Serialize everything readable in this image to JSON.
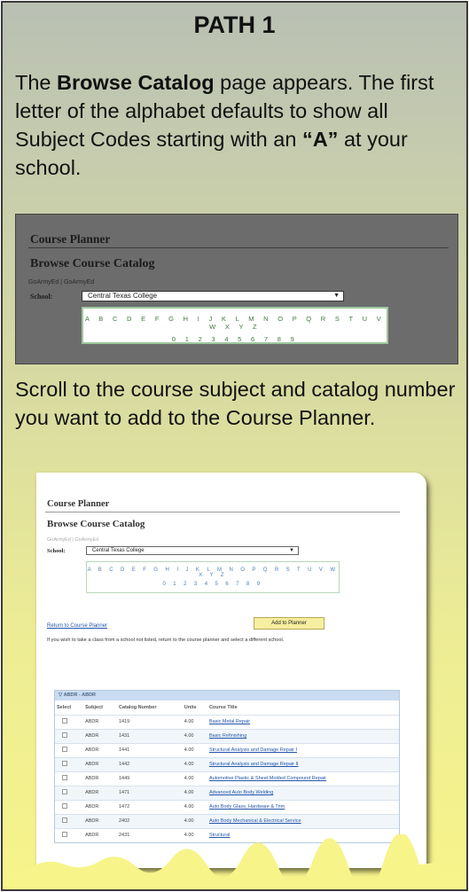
{
  "title": "PATH 1",
  "intro": {
    "part1": "The ",
    "bold1": "Browse Catalog",
    "part2": " page appears. The first letter of the alphabet defaults to show all Subject Codes starting with an ",
    "bold2": "“A”",
    "part3": " at your school."
  },
  "shot1": {
    "course_planner": "Course Planner",
    "browse_title": "Browse Course Catalog",
    "links": "GoArmyEd | GoArmyEd",
    "school_label": "School:",
    "school_value": "Central Texas College",
    "letters": "A B C D E F G H I J K L M N O P Q R S T U V W X Y Z",
    "digits": "0 1 2 3 4 5 6 7 8 9"
  },
  "scroll_text": "Scroll to the course subject and catalog number you want to add to the Course Planner.",
  "shot2": {
    "course_planner": "Course Planner",
    "browse_title": "Browse Course Catalog",
    "links": "GoArmyEd | GoArmyEd",
    "school_label": "School:",
    "school_value": "Central Texas College",
    "letters": "A B C D E F G H I J K L M N O P Q R S T U V W X Y Z",
    "digits": "0 1 2 3 4 5 6 7 8 9",
    "return_link": "Return to Course Planner",
    "add_button": "Add to Planner",
    "note": "If you wish to take a class from a school not listed, return to the course planner and select a different school.",
    "group_header": "ABDR - ABDR",
    "columns": [
      "Select",
      "Subject",
      "Catalog Number",
      "Units",
      "Course Title"
    ],
    "rows": [
      [
        "ABDR",
        "1419",
        "4.00",
        "Basic Metal Repair"
      ],
      [
        "ABDR",
        "1431",
        "4.00",
        "Basic Refinishing"
      ],
      [
        "ABDR",
        "1441",
        "4.00",
        "Structural Analysis and Damage Repair I"
      ],
      [
        "ABDR",
        "1442",
        "4.00",
        "Structural Analysis and Damage Repair II"
      ],
      [
        "ABDR",
        "1449",
        "4.00",
        "Automotive Plastic & Sheet Molded Compound Repair"
      ],
      [
        "ABDR",
        "1471",
        "4.00",
        "Advanced Auto Body Welding"
      ],
      [
        "ABDR",
        "1472",
        "4.00",
        "Auto Body Glass, Hardware & Trim"
      ],
      [
        "ABDR",
        "2402",
        "4.00",
        "Auto Body Mechanical & Electrical Service"
      ],
      [
        "ABDR",
        "2431",
        "4.00",
        "Structural"
      ]
    ]
  }
}
